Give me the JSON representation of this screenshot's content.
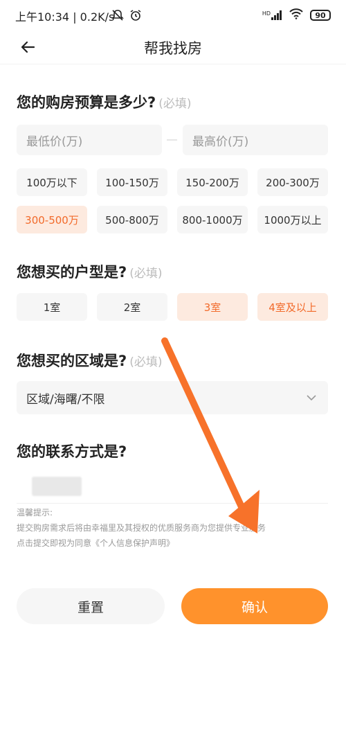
{
  "status_bar": {
    "time_speed": "上午10:34 | 0.2K/s",
    "signal_label": "HD",
    "battery": "90"
  },
  "header": {
    "title": "帮我找房"
  },
  "budget": {
    "title": "您的购房预算是多少?",
    "required": "(必填)",
    "min_placeholder": "最低价(万)",
    "max_placeholder": "最高价(万)",
    "options": [
      "100万以下",
      "100-150万",
      "150-200万",
      "200-300万",
      "300-500万",
      "500-800万",
      "800-1000万",
      "1000万以上"
    ],
    "selected": "300-500万"
  },
  "room_type": {
    "title": "您想买的户型是?",
    "required": "(必填)",
    "options": [
      "1室",
      "2室",
      "3室",
      "4室及以上"
    ],
    "selected": [
      "3室",
      "4室及以上"
    ]
  },
  "area": {
    "title": "您想买的区域是?",
    "required": "(必填)",
    "value": "区域/海曙/不限"
  },
  "contact": {
    "title": "您的联系方式是?"
  },
  "tips": {
    "heading": "温馨提示:",
    "line1": "提交购房需求后将由幸福里及其授权的优质服务商为您提供专业服务",
    "line2_prefix": "点击提交即视为同意",
    "line2_link": "《个人信息保护声明》"
  },
  "buttons": {
    "reset": "重置",
    "confirm": "确认"
  },
  "colors": {
    "accent": "#ff922c",
    "selected_text": "#f26a2a",
    "selected_bg": "#fdeadf",
    "annotation_arrow": "#f7722a"
  }
}
